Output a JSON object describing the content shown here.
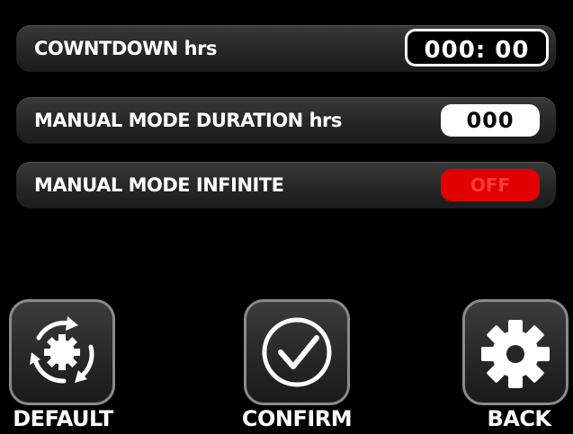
{
  "settings": {
    "rows": [
      {
        "label": "COWNTDOWN  hrs",
        "value": "000: 00"
      },
      {
        "label": "MANUAL MODE DURATION hrs",
        "value": "000"
      },
      {
        "label": "MANUAL MODE INFINITE",
        "value": "OFF"
      }
    ]
  },
  "buttons": {
    "default_label": "DEFAULT",
    "default_icon": "reset-cycle-icon",
    "confirm_label": "CONFIRM",
    "confirm_icon": "check-circle-icon",
    "back_label": "BACK",
    "back_icon": "gear-icon"
  },
  "colors": {
    "background": "#000000",
    "row_fill": "#2a2a2a",
    "off_red": "#e00000",
    "text": "#ffffff"
  }
}
